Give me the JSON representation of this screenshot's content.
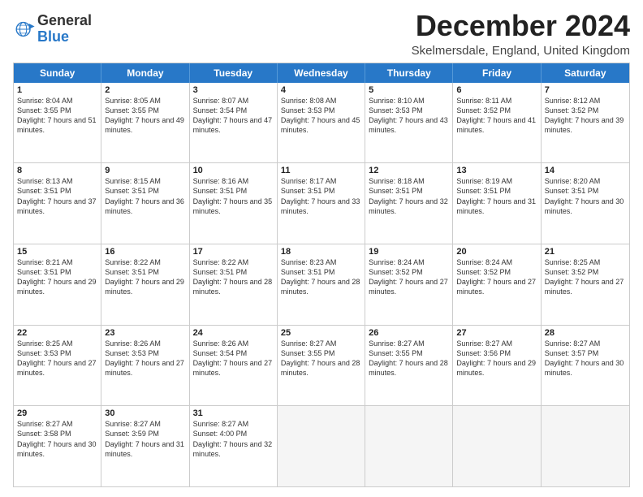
{
  "logo": {
    "general": "General",
    "blue": "Blue"
  },
  "title": "December 2024",
  "subtitle": "Skelmersdale, England, United Kingdom",
  "days": [
    "Sunday",
    "Monday",
    "Tuesday",
    "Wednesday",
    "Thursday",
    "Friday",
    "Saturday"
  ],
  "weeks": [
    [
      {
        "day": "1",
        "rise": "Sunrise: 8:04 AM",
        "set": "Sunset: 3:55 PM",
        "daylight": "Daylight: 7 hours and 51 minutes."
      },
      {
        "day": "2",
        "rise": "Sunrise: 8:05 AM",
        "set": "Sunset: 3:55 PM",
        "daylight": "Daylight: 7 hours and 49 minutes."
      },
      {
        "day": "3",
        "rise": "Sunrise: 8:07 AM",
        "set": "Sunset: 3:54 PM",
        "daylight": "Daylight: 7 hours and 47 minutes."
      },
      {
        "day": "4",
        "rise": "Sunrise: 8:08 AM",
        "set": "Sunset: 3:53 PM",
        "daylight": "Daylight: 7 hours and 45 minutes."
      },
      {
        "day": "5",
        "rise": "Sunrise: 8:10 AM",
        "set": "Sunset: 3:53 PM",
        "daylight": "Daylight: 7 hours and 43 minutes."
      },
      {
        "day": "6",
        "rise": "Sunrise: 8:11 AM",
        "set": "Sunset: 3:52 PM",
        "daylight": "Daylight: 7 hours and 41 minutes."
      },
      {
        "day": "7",
        "rise": "Sunrise: 8:12 AM",
        "set": "Sunset: 3:52 PM",
        "daylight": "Daylight: 7 hours and 39 minutes."
      }
    ],
    [
      {
        "day": "8",
        "rise": "Sunrise: 8:13 AM",
        "set": "Sunset: 3:51 PM",
        "daylight": "Daylight: 7 hours and 37 minutes."
      },
      {
        "day": "9",
        "rise": "Sunrise: 8:15 AM",
        "set": "Sunset: 3:51 PM",
        "daylight": "Daylight: 7 hours and 36 minutes."
      },
      {
        "day": "10",
        "rise": "Sunrise: 8:16 AM",
        "set": "Sunset: 3:51 PM",
        "daylight": "Daylight: 7 hours and 35 minutes."
      },
      {
        "day": "11",
        "rise": "Sunrise: 8:17 AM",
        "set": "Sunset: 3:51 PM",
        "daylight": "Daylight: 7 hours and 33 minutes."
      },
      {
        "day": "12",
        "rise": "Sunrise: 8:18 AM",
        "set": "Sunset: 3:51 PM",
        "daylight": "Daylight: 7 hours and 32 minutes."
      },
      {
        "day": "13",
        "rise": "Sunrise: 8:19 AM",
        "set": "Sunset: 3:51 PM",
        "daylight": "Daylight: 7 hours and 31 minutes."
      },
      {
        "day": "14",
        "rise": "Sunrise: 8:20 AM",
        "set": "Sunset: 3:51 PM",
        "daylight": "Daylight: 7 hours and 30 minutes."
      }
    ],
    [
      {
        "day": "15",
        "rise": "Sunrise: 8:21 AM",
        "set": "Sunset: 3:51 PM",
        "daylight": "Daylight: 7 hours and 29 minutes."
      },
      {
        "day": "16",
        "rise": "Sunrise: 8:22 AM",
        "set": "Sunset: 3:51 PM",
        "daylight": "Daylight: 7 hours and 29 minutes."
      },
      {
        "day": "17",
        "rise": "Sunrise: 8:22 AM",
        "set": "Sunset: 3:51 PM",
        "daylight": "Daylight: 7 hours and 28 minutes."
      },
      {
        "day": "18",
        "rise": "Sunrise: 8:23 AM",
        "set": "Sunset: 3:51 PM",
        "daylight": "Daylight: 7 hours and 28 minutes."
      },
      {
        "day": "19",
        "rise": "Sunrise: 8:24 AM",
        "set": "Sunset: 3:52 PM",
        "daylight": "Daylight: 7 hours and 27 minutes."
      },
      {
        "day": "20",
        "rise": "Sunrise: 8:24 AM",
        "set": "Sunset: 3:52 PM",
        "daylight": "Daylight: 7 hours and 27 minutes."
      },
      {
        "day": "21",
        "rise": "Sunrise: 8:25 AM",
        "set": "Sunset: 3:52 PM",
        "daylight": "Daylight: 7 hours and 27 minutes."
      }
    ],
    [
      {
        "day": "22",
        "rise": "Sunrise: 8:25 AM",
        "set": "Sunset: 3:53 PM",
        "daylight": "Daylight: 7 hours and 27 minutes."
      },
      {
        "day": "23",
        "rise": "Sunrise: 8:26 AM",
        "set": "Sunset: 3:53 PM",
        "daylight": "Daylight: 7 hours and 27 minutes."
      },
      {
        "day": "24",
        "rise": "Sunrise: 8:26 AM",
        "set": "Sunset: 3:54 PM",
        "daylight": "Daylight: 7 hours and 27 minutes."
      },
      {
        "day": "25",
        "rise": "Sunrise: 8:27 AM",
        "set": "Sunset: 3:55 PM",
        "daylight": "Daylight: 7 hours and 28 minutes."
      },
      {
        "day": "26",
        "rise": "Sunrise: 8:27 AM",
        "set": "Sunset: 3:55 PM",
        "daylight": "Daylight: 7 hours and 28 minutes."
      },
      {
        "day": "27",
        "rise": "Sunrise: 8:27 AM",
        "set": "Sunset: 3:56 PM",
        "daylight": "Daylight: 7 hours and 29 minutes."
      },
      {
        "day": "28",
        "rise": "Sunrise: 8:27 AM",
        "set": "Sunset: 3:57 PM",
        "daylight": "Daylight: 7 hours and 30 minutes."
      }
    ],
    [
      {
        "day": "29",
        "rise": "Sunrise: 8:27 AM",
        "set": "Sunset: 3:58 PM",
        "daylight": "Daylight: 7 hours and 30 minutes."
      },
      {
        "day": "30",
        "rise": "Sunrise: 8:27 AM",
        "set": "Sunset: 3:59 PM",
        "daylight": "Daylight: 7 hours and 31 minutes."
      },
      {
        "day": "31",
        "rise": "Sunrise: 8:27 AM",
        "set": "Sunset: 4:00 PM",
        "daylight": "Daylight: 7 hours and 32 minutes."
      },
      {
        "day": "",
        "rise": "",
        "set": "",
        "daylight": ""
      },
      {
        "day": "",
        "rise": "",
        "set": "",
        "daylight": ""
      },
      {
        "day": "",
        "rise": "",
        "set": "",
        "daylight": ""
      },
      {
        "day": "",
        "rise": "",
        "set": "",
        "daylight": ""
      }
    ]
  ]
}
